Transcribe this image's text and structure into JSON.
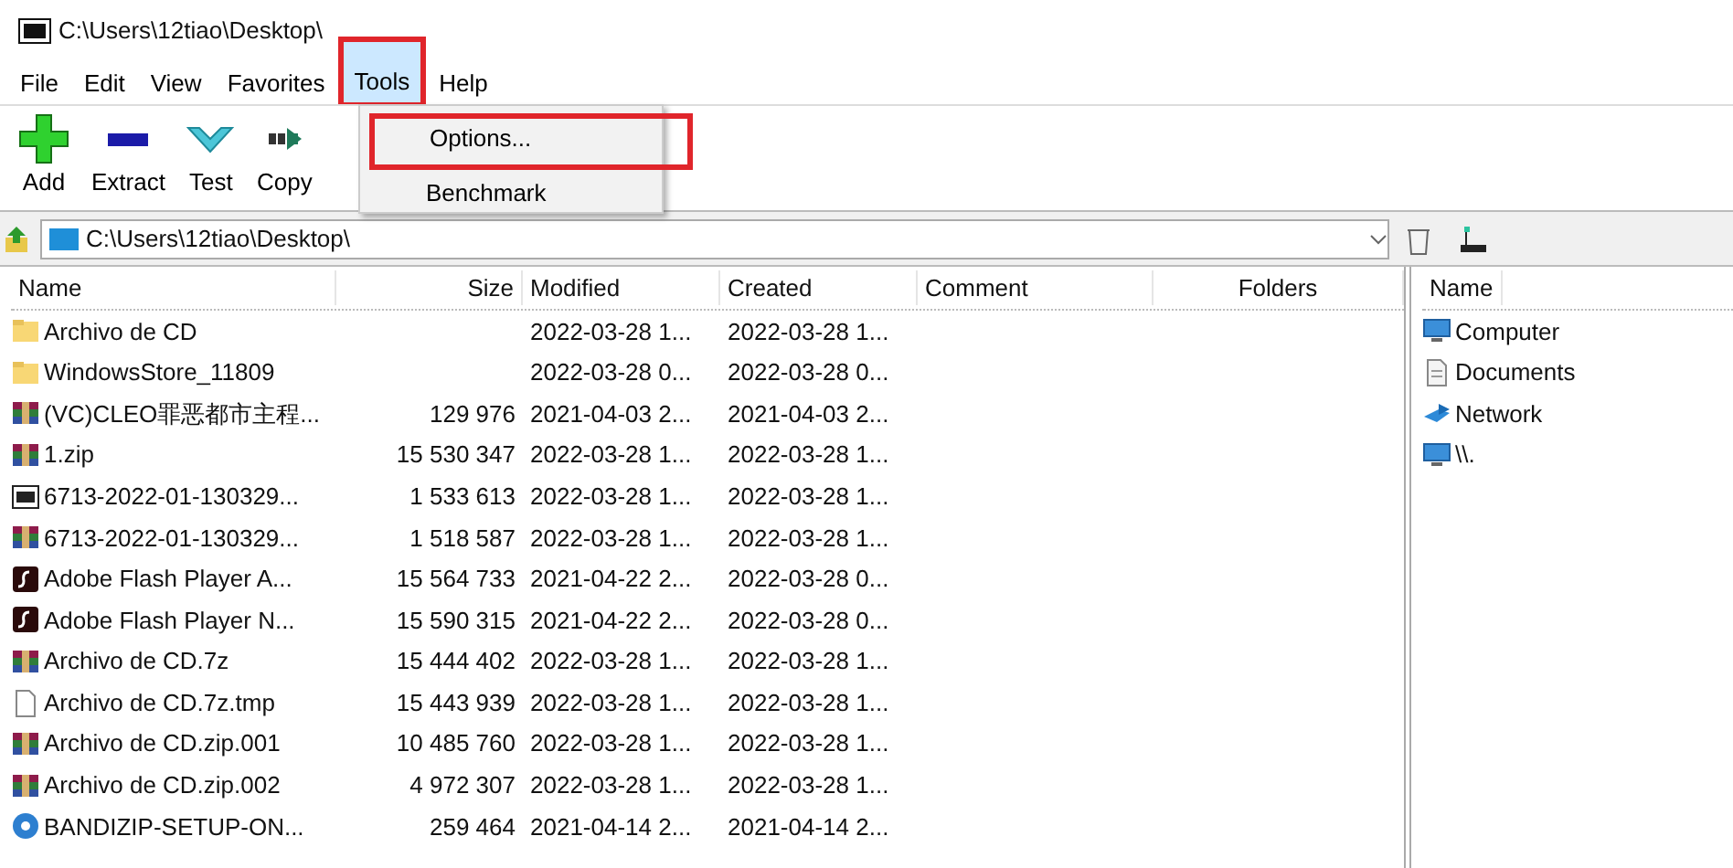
{
  "window": {
    "title": "C:\\Users\\12tiao\\Desktop\\"
  },
  "menu": [
    {
      "label": "File",
      "selected": false,
      "highlighted": false
    },
    {
      "label": "Edit",
      "selected": false,
      "highlighted": false
    },
    {
      "label": "View",
      "selected": false,
      "highlighted": false
    },
    {
      "label": "Favorites",
      "selected": false,
      "highlighted": false
    },
    {
      "label": "Tools",
      "selected": true,
      "highlighted": true
    },
    {
      "label": "Help",
      "selected": false,
      "highlighted": false
    }
  ],
  "dropdown": [
    {
      "label": "Options...",
      "highlighted": true
    },
    {
      "label": "Benchmark",
      "highlighted": false
    }
  ],
  "toolbar": [
    {
      "label": "Add",
      "kind": "add"
    },
    {
      "label": "Extract",
      "kind": "extract"
    },
    {
      "label": "Test",
      "kind": "test"
    },
    {
      "label": "Copy",
      "kind": "copy"
    }
  ],
  "address": "C:\\Users\\12tiao\\Desktop\\",
  "table": {
    "columns": [
      "Name",
      "Size",
      "Modified",
      "Created",
      "Comment",
      "Folders"
    ],
    "rows": [
      {
        "kind": "folder",
        "name": "Archivo de CD",
        "size": "",
        "modified": "2022-03-28 1...",
        "created": "2022-03-28 1..."
      },
      {
        "kind": "folder",
        "name": "WindowsStore_11809",
        "size": "",
        "modified": "2022-03-28 0...",
        "created": "2022-03-28 0..."
      },
      {
        "kind": "rar",
        "name": "(VC)CLEO罪恶都市主程...",
        "size": "129 976",
        "modified": "2021-04-03 2...",
        "created": "2021-04-03 2..."
      },
      {
        "kind": "rar",
        "name": "1.zip",
        "size": "15 530 347",
        "modified": "2022-03-28 1...",
        "created": "2022-03-28 1..."
      },
      {
        "kind": "sevenzip",
        "name": "6713-2022-01-130329...",
        "size": "1 533 613",
        "modified": "2022-03-28 1...",
        "created": "2022-03-28 1..."
      },
      {
        "kind": "rar",
        "name": "6713-2022-01-130329...",
        "size": "1 518 587",
        "modified": "2022-03-28 1...",
        "created": "2022-03-28 1..."
      },
      {
        "kind": "flash",
        "name": "Adobe Flash Player A...",
        "size": "15 564 733",
        "modified": "2021-04-22 2...",
        "created": "2022-03-28 0..."
      },
      {
        "kind": "flash",
        "name": "Adobe Flash Player N...",
        "size": "15 590 315",
        "modified": "2021-04-22 2...",
        "created": "2022-03-28 0..."
      },
      {
        "kind": "rar",
        "name": "Archivo de CD.7z",
        "size": "15 444 402",
        "modified": "2022-03-28 1...",
        "created": "2022-03-28 1..."
      },
      {
        "kind": "file",
        "name": "Archivo de CD.7z.tmp",
        "size": "15 443 939",
        "modified": "2022-03-28 1...",
        "created": "2022-03-28 1..."
      },
      {
        "kind": "rar",
        "name": "Archivo de CD.zip.001",
        "size": "10 485 760",
        "modified": "2022-03-28 1...",
        "created": "2022-03-28 1..."
      },
      {
        "kind": "rar",
        "name": "Archivo de CD.zip.002",
        "size": "4 972 307",
        "modified": "2022-03-28 1...",
        "created": "2022-03-28 1..."
      },
      {
        "kind": "setup",
        "name": "BANDIZIP-SETUP-ON...",
        "size": "259 464",
        "modified": "2021-04-14 2...",
        "created": "2021-04-14 2..."
      }
    ]
  },
  "side_pane": {
    "column": "Name",
    "items": [
      {
        "kind": "computer",
        "label": "Computer"
      },
      {
        "kind": "documents",
        "label": "Documents"
      },
      {
        "kind": "network",
        "label": "Network"
      },
      {
        "kind": "computer",
        "label": "\\\\."
      }
    ]
  }
}
